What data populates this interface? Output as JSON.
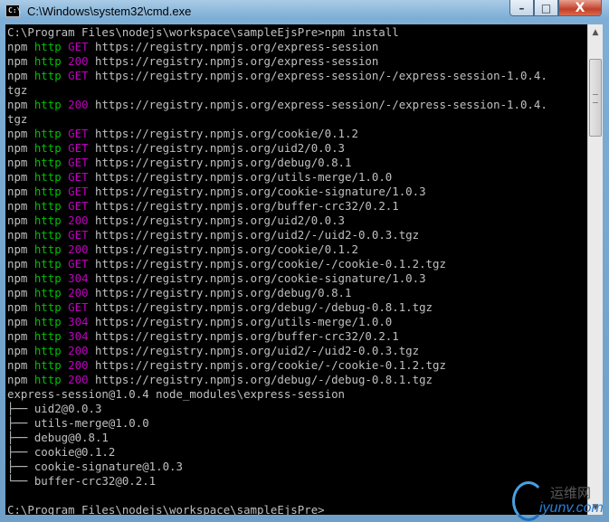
{
  "window": {
    "title": "C:\\Windows\\system32\\cmd.exe",
    "icon_label": "C:\\",
    "controls": {
      "minimize": "–",
      "maximize": "□",
      "close": "X"
    }
  },
  "console": {
    "lines": [
      [
        {
          "t": "C:\\Program Files\\nodejs\\workspace\\sampleEjsPre>npm install"
        }
      ],
      [
        {
          "t": "npm "
        },
        {
          "t": "http",
          "c": "green"
        },
        {
          "t": " "
        },
        {
          "t": "GET",
          "c": "purple"
        },
        {
          "t": " https://registry.npmjs.org/express-session"
        }
      ],
      [
        {
          "t": "npm "
        },
        {
          "t": "http",
          "c": "green"
        },
        {
          "t": " "
        },
        {
          "t": "200",
          "c": "purple"
        },
        {
          "t": " https://registry.npmjs.org/express-session"
        }
      ],
      [
        {
          "t": "npm "
        },
        {
          "t": "http",
          "c": "green"
        },
        {
          "t": " "
        },
        {
          "t": "GET",
          "c": "purple"
        },
        {
          "t": " https://registry.npmjs.org/express-session/-/express-session-1.0.4."
        }
      ],
      [
        {
          "t": "tgz"
        }
      ],
      [
        {
          "t": "npm "
        },
        {
          "t": "http",
          "c": "green"
        },
        {
          "t": " "
        },
        {
          "t": "200",
          "c": "purple"
        },
        {
          "t": " https://registry.npmjs.org/express-session/-/express-session-1.0.4."
        }
      ],
      [
        {
          "t": "tgz"
        }
      ],
      [
        {
          "t": "npm "
        },
        {
          "t": "http",
          "c": "green"
        },
        {
          "t": " "
        },
        {
          "t": "GET",
          "c": "purple"
        },
        {
          "t": " https://registry.npmjs.org/cookie/0.1.2"
        }
      ],
      [
        {
          "t": "npm "
        },
        {
          "t": "http",
          "c": "green"
        },
        {
          "t": " "
        },
        {
          "t": "GET",
          "c": "purple"
        },
        {
          "t": " https://registry.npmjs.org/uid2/0.0.3"
        }
      ],
      [
        {
          "t": "npm "
        },
        {
          "t": "http",
          "c": "green"
        },
        {
          "t": " "
        },
        {
          "t": "GET",
          "c": "purple"
        },
        {
          "t": " https://registry.npmjs.org/debug/0.8.1"
        }
      ],
      [
        {
          "t": "npm "
        },
        {
          "t": "http",
          "c": "green"
        },
        {
          "t": " "
        },
        {
          "t": "GET",
          "c": "purple"
        },
        {
          "t": " https://registry.npmjs.org/utils-merge/1.0.0"
        }
      ],
      [
        {
          "t": "npm "
        },
        {
          "t": "http",
          "c": "green"
        },
        {
          "t": " "
        },
        {
          "t": "GET",
          "c": "purple"
        },
        {
          "t": " https://registry.npmjs.org/cookie-signature/1.0.3"
        }
      ],
      [
        {
          "t": "npm "
        },
        {
          "t": "http",
          "c": "green"
        },
        {
          "t": " "
        },
        {
          "t": "GET",
          "c": "purple"
        },
        {
          "t": " https://registry.npmjs.org/buffer-crc32/0.2.1"
        }
      ],
      [
        {
          "t": "npm "
        },
        {
          "t": "http",
          "c": "green"
        },
        {
          "t": " "
        },
        {
          "t": "200",
          "c": "purple"
        },
        {
          "t": " https://registry.npmjs.org/uid2/0.0.3"
        }
      ],
      [
        {
          "t": "npm "
        },
        {
          "t": "http",
          "c": "green"
        },
        {
          "t": " "
        },
        {
          "t": "GET",
          "c": "purple"
        },
        {
          "t": " https://registry.npmjs.org/uid2/-/uid2-0.0.3.tgz"
        }
      ],
      [
        {
          "t": "npm "
        },
        {
          "t": "http",
          "c": "green"
        },
        {
          "t": " "
        },
        {
          "t": "200",
          "c": "purple"
        },
        {
          "t": " https://registry.npmjs.org/cookie/0.1.2"
        }
      ],
      [
        {
          "t": "npm "
        },
        {
          "t": "http",
          "c": "green"
        },
        {
          "t": " "
        },
        {
          "t": "GET",
          "c": "purple"
        },
        {
          "t": " https://registry.npmjs.org/cookie/-/cookie-0.1.2.tgz"
        }
      ],
      [
        {
          "t": "npm "
        },
        {
          "t": "http",
          "c": "green"
        },
        {
          "t": " "
        },
        {
          "t": "304",
          "c": "purple"
        },
        {
          "t": " https://registry.npmjs.org/cookie-signature/1.0.3"
        }
      ],
      [
        {
          "t": "npm "
        },
        {
          "t": "http",
          "c": "green"
        },
        {
          "t": " "
        },
        {
          "t": "200",
          "c": "purple"
        },
        {
          "t": " https://registry.npmjs.org/debug/0.8.1"
        }
      ],
      [
        {
          "t": "npm "
        },
        {
          "t": "http",
          "c": "green"
        },
        {
          "t": " "
        },
        {
          "t": "GET",
          "c": "purple"
        },
        {
          "t": " https://registry.npmjs.org/debug/-/debug-0.8.1.tgz"
        }
      ],
      [
        {
          "t": "npm "
        },
        {
          "t": "http",
          "c": "green"
        },
        {
          "t": " "
        },
        {
          "t": "304",
          "c": "purple"
        },
        {
          "t": " https://registry.npmjs.org/utils-merge/1.0.0"
        }
      ],
      [
        {
          "t": "npm "
        },
        {
          "t": "http",
          "c": "green"
        },
        {
          "t": " "
        },
        {
          "t": "304",
          "c": "purple"
        },
        {
          "t": " https://registry.npmjs.org/buffer-crc32/0.2.1"
        }
      ],
      [
        {
          "t": "npm "
        },
        {
          "t": "http",
          "c": "green"
        },
        {
          "t": " "
        },
        {
          "t": "200",
          "c": "purple"
        },
        {
          "t": " https://registry.npmjs.org/uid2/-/uid2-0.0.3.tgz"
        }
      ],
      [
        {
          "t": "npm "
        },
        {
          "t": "http",
          "c": "green"
        },
        {
          "t": " "
        },
        {
          "t": "200",
          "c": "purple"
        },
        {
          "t": " https://registry.npmjs.org/cookie/-/cookie-0.1.2.tgz"
        }
      ],
      [
        {
          "t": "npm "
        },
        {
          "t": "http",
          "c": "green"
        },
        {
          "t": " "
        },
        {
          "t": "200",
          "c": "purple"
        },
        {
          "t": " https://registry.npmjs.org/debug/-/debug-0.8.1.tgz"
        }
      ],
      [
        {
          "t": "express-session@1.0.4 node_modules\\express-session"
        }
      ],
      [
        {
          "t": "├── uid2@0.0.3"
        }
      ],
      [
        {
          "t": "├── utils-merge@1.0.0"
        }
      ],
      [
        {
          "t": "├── debug@0.8.1"
        }
      ],
      [
        {
          "t": "├── cookie@0.1.2"
        }
      ],
      [
        {
          "t": "├── cookie-signature@1.0.3"
        }
      ],
      [
        {
          "t": "└── buffer-crc32@0.2.1"
        }
      ],
      [
        {
          "t": ""
        }
      ],
      [
        {
          "t": "C:\\Program Files\\nodejs\\workspace\\sampleEjsPre>_"
        }
      ]
    ]
  },
  "scrollbar": {
    "up_arrow": "▲",
    "down_arrow": "▼"
  },
  "watermark": {
    "text": "运维网",
    "sub": "iyunv.com"
  },
  "colors": {
    "console_bg": "#000000",
    "console_text": "#c0c0c0",
    "http_green": "#00c000",
    "status_purple": "#c000c0"
  }
}
